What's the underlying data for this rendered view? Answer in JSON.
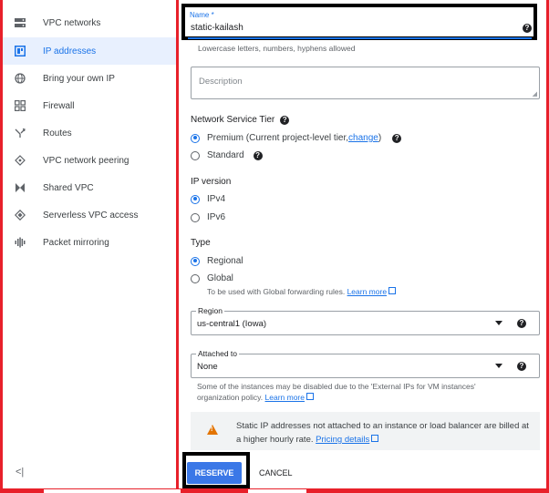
{
  "sidebar": {
    "items": [
      {
        "label": "VPC networks",
        "icon": "vpc-networks-icon",
        "active": false
      },
      {
        "label": "IP addresses",
        "icon": "ip-addresses-icon",
        "active": true
      },
      {
        "label": "Bring your own IP",
        "icon": "globe-icon",
        "active": false
      },
      {
        "label": "Firewall",
        "icon": "firewall-icon",
        "active": false
      },
      {
        "label": "Routes",
        "icon": "routes-icon",
        "active": false
      },
      {
        "label": "VPC network peering",
        "icon": "peering-icon",
        "active": false
      },
      {
        "label": "Shared VPC",
        "icon": "shared-vpc-icon",
        "active": false
      },
      {
        "label": "Serverless VPC access",
        "icon": "serverless-icon",
        "active": false
      },
      {
        "label": "Packet mirroring",
        "icon": "packet-mirroring-icon",
        "active": false
      }
    ],
    "collapse_label": "<|"
  },
  "form": {
    "name": {
      "label": "Name *",
      "value": "static-kailash",
      "hint": "Lowercase letters, numbers, hyphens allowed"
    },
    "description": {
      "placeholder": "Description"
    },
    "tier": {
      "title": "Network Service Tier",
      "premium": "Premium (Current project-level tier, ",
      "change": "change",
      "premium_close": ")",
      "standard": "Standard",
      "selected": "Premium"
    },
    "ip_version": {
      "title": "IP version",
      "options": [
        "IPv4",
        "IPv6"
      ],
      "selected": "IPv4"
    },
    "type": {
      "title": "Type",
      "regional": "Regional",
      "global": "Global",
      "global_hint": "To be used with Global forwarding rules.",
      "learn_more": "Learn more",
      "selected": "Regional"
    },
    "region": {
      "label": "Region",
      "value": "us-central1 (Iowa)"
    },
    "attached_to": {
      "label": "Attached to",
      "value": "None",
      "hint": "Some of the instances may be disabled due to the 'External IPs for VM instances' organization policy.",
      "learn_more": "Learn more"
    },
    "alert": {
      "text": "Static IP addresses not attached to an instance or load balancer are billed at a higher hourly rate.",
      "link": "Pricing details"
    },
    "reserve_label": "RESERVE",
    "cancel_label": "CANCEL"
  },
  "colors": {
    "accent": "#1a73e8",
    "annotation": "#e8202a",
    "warning": "#e37400"
  }
}
